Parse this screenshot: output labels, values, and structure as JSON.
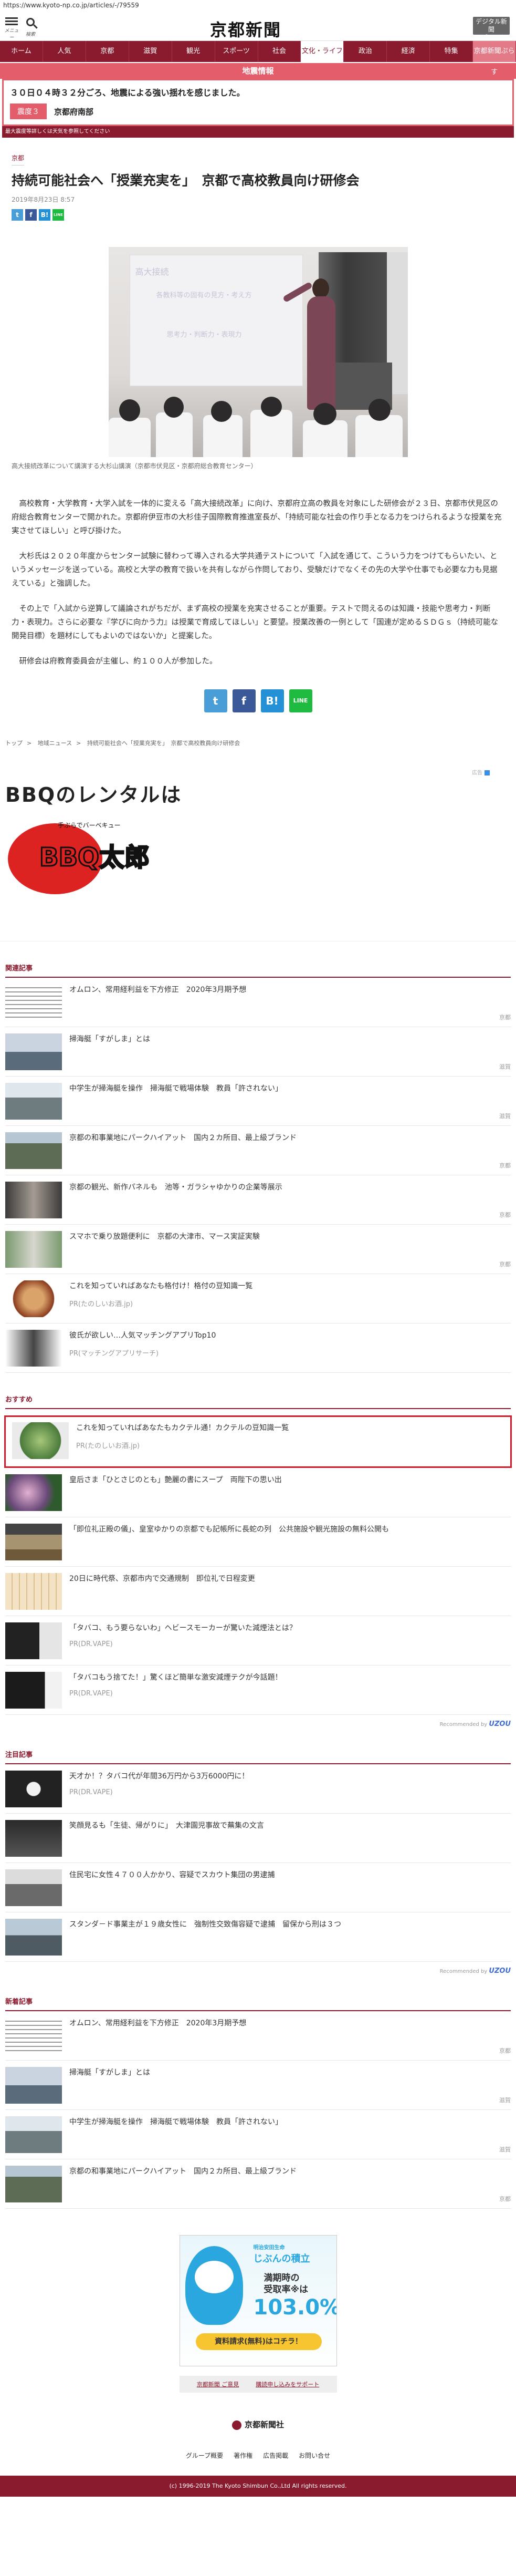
{
  "url": "https://www.kyoto-np.co.jp/articles/-/79559",
  "header": {
    "menu_label": "メニュー",
    "search_label": "検索",
    "logo": "京都新聞",
    "print_label_1": "デジタル新聞",
    "print_label_2": "&プリント"
  },
  "nav": [
    "ホーム",
    "人気",
    "京都",
    "滋賀",
    "観光",
    "スポーツ",
    "社会",
    "文化・ライフ",
    "政治",
    "経済",
    "特集",
    "京都新聞ぷらす"
  ],
  "alert": {
    "head": "地震情報",
    "title": "３０日０４時３２分ごろ、地震による強い揺れを感じました。",
    "badge": "震度３",
    "region": "京都府南部",
    "note": "最大震度等詳しくは天気を参照してください"
  },
  "article": {
    "category": "京都",
    "title": "持続可能社会へ「授業充実を」　京都で高校教員向け研修会",
    "date": "2019年8月23日 8:57",
    "caption": "高大接続改革について講演する大杉山講演（京都市伏見区・京都府総合教育センター）",
    "paragraphs": [
      "高校教育・大学教育・大学入試を一体的に変える「高大接続改革」に向け、京都府立高の教員を対象にした研修会が２３日、京都市伏見区の府総合教育センターで開かれた。京都府伊豆市の大杉佳子国際教育推進室長が、「持続可能な社会の作り手となる力をつけられるような授業を充実させてほしい」と呼び掛けた。",
      "大杉氏は２０２０年度からセンター試験に替わって導入される大学共通テストについて「入試を通じて、こういう力をつけてもらいたい、というメッセージを送っている。高校と大学の教育で扱いを共有しながら作問しており、受験だけでなくその先の大学や仕事でも必要な力も見据えている」と強調した。",
      "その上で「入試から逆算して議論されがちだが、まず高校の授業を充実させることが重要。テストで問えるのは知識・技能や思考力・判断力・表現力。さらに必要な『学びに向かう力』は授業で育成してほしい」と要望。授業改善の一例として「国連が定めるＳＤＧｓ（持続可能な開発目標）を題材にしてもよいのではないか」と提案した。",
      "研修会は府教育委員会が主催し、約１００人が参加した。"
    ]
  },
  "screen_text": [
    "高大接続",
    "各教科等の固有の見方・考え方",
    "思考力・判断力・表現力"
  ],
  "share": {
    "twitter": "t",
    "facebook": "f",
    "hatena": "B!",
    "line": "LINE"
  },
  "breadcrumb": [
    "トップ",
    "地域ニュース",
    "持続可能社会へ「授業充実を」　京都で高校教員向け研修会"
  ],
  "ad_bbq": {
    "tag": "広告",
    "title": "BBQのレンタルは",
    "sub": "手ぶらでバーベキュー",
    "logo": "BBQ太郎"
  },
  "sections": {
    "related": "関連記事",
    "recommend": "おすすめ",
    "attention": "注目記事",
    "latest": "新着記事"
  },
  "related": [
    {
      "title": "オムロン、常用経利益を下方修正　2020年3月期予想",
      "tag": "京都"
    },
    {
      "title": "掃海艇「すがしま」とは",
      "tag": "滋賀"
    },
    {
      "title": "中学生が掃海艇を操作　掃海艇で戦場体験　教員「許されない」",
      "tag": "滋賀"
    },
    {
      "title": "京都の和事業地にパークハイアット　国内２カ所目、最上級ブランド",
      "tag": "京都"
    },
    {
      "title": "京都の観光、新作パネルも　池等・ガラシャゆかりの企業等展示",
      "tag": "京都"
    },
    {
      "title": "スマホで乗り放題便利に　京都の大津市、マース実証実験",
      "tag": "京都"
    },
    {
      "title": "これを知っていればあなたも格付け！格付の豆知識一覧",
      "pr": "PR(たのしいお酒.jp)"
    },
    {
      "title": "彼氏が欲しい…人気マッチングアプリTop10",
      "pr": "PR(マッチングアプリサーチ)"
    }
  ],
  "recommend": [
    {
      "title": "これを知っていればあなたもカクテル通！カクテルの豆知識一覧",
      "pr": "PR(たのしいお酒.jp)"
    },
    {
      "title": "皇后さま「ひとさじのとも」艶麗の書にスープ　両陛下の思い出"
    },
    {
      "title": "「即位礼正殿の儀」、皇室ゆかりの京都でも記帳所に長蛇の列　公共施設や観光施設の無料公開も"
    },
    {
      "title": "20日に時代祭、京都市内で交通規制　即位礼で日程変更"
    },
    {
      "title": "「タバコ、もう要らないわ」ヘビースモーカーが驚いた減煙法とは？",
      "pr": "PR(DR.VAPE)"
    },
    {
      "title": "「タバコもう捨てた！」驚くほど簡単な激安減煙テクが今話題！",
      "pr": "PR(DR.VAPE)"
    }
  ],
  "recommended_by": "Recommended by",
  "uzou": "UZOU",
  "attention": [
    {
      "title": "天才か！？タバコ代が年間36万円から3万6000円に！",
      "pr": "PR(DR.VAPE)"
    },
    {
      "title": "笑顔見るも「生徒、帰がりに」　大津園児事故で蕪集の文言"
    },
    {
      "title": "住民宅に女性４７００人かかり、容疑でスカウト集団の男逮捕"
    },
    {
      "title": "スタンダ－ド事業主が１９歳女性に　強制性交致傷容疑で逮捕　留保から刑は３つ"
    }
  ],
  "latest": [
    {
      "title": "オムロン、常用経利益を下方修正　2020年3月期予想",
      "tag": "京都"
    },
    {
      "title": "掃海艇「すがしま」とは",
      "tag": "滋賀"
    },
    {
      "title": "中学生が掃海艇を操作　掃海艇で戦場体験　教員「許されない」",
      "tag": "滋賀"
    },
    {
      "title": "京都の和事業地にパークハイアット　国内２カ所目、最上級ブランド",
      "tag": "京都"
    }
  ],
  "ad_bottom": {
    "top": "明治安田生命",
    "brand": "じぶんの積立",
    "line1": "満期時の",
    "line2": "受取率※は",
    "rate": "103.0%",
    "cta": "資料請求(無料)はコチラ！"
  },
  "pill_btns": [
    "京都新聞 ご意見",
    "購読申し込みをサポート"
  ],
  "footer": {
    "logo": "京都新聞社",
    "links": [
      "グループ概要",
      "著作権",
      "広告掲載",
      "お問い合せ"
    ],
    "copyright": "(c) 1996-2019 The Kyoto Shimbun Co.,Ltd All rights reserved."
  },
  "colors": {
    "brand": "#8a1a2e",
    "alert": "#e35d6a",
    "highlight": "#d11a2a",
    "twitter": "#4a9ed8",
    "facebook": "#3b5998",
    "hatena": "#2491d6",
    "line": "#1ebb40"
  }
}
